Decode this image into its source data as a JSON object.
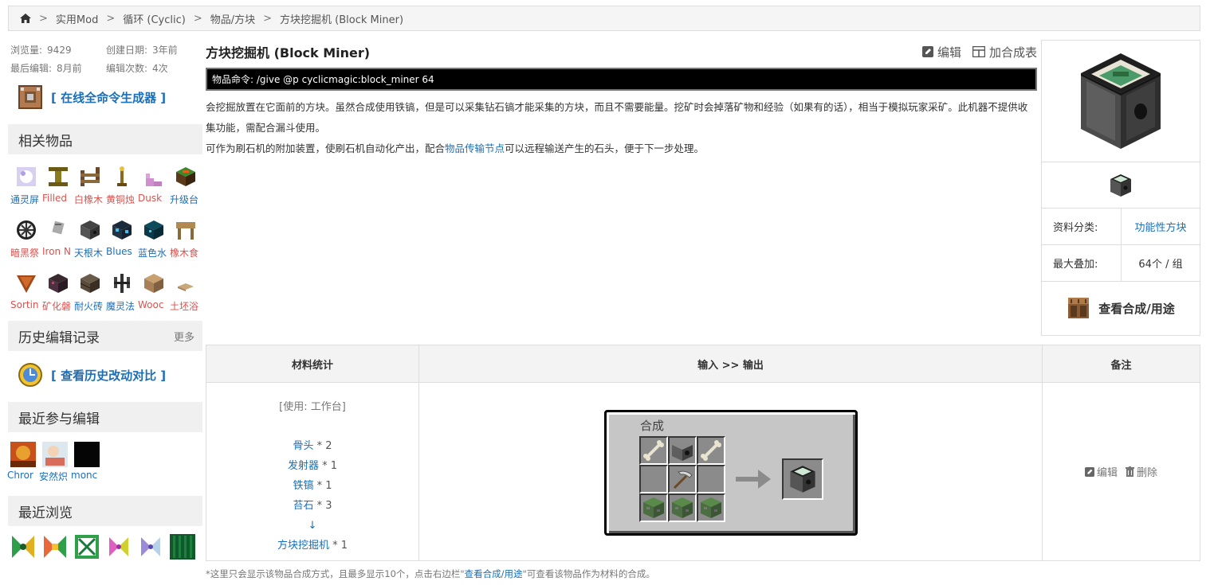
{
  "breadcrumb": {
    "home_icon": "home-icon",
    "items": [
      "实用Mod",
      "循环 (Cyclic)",
      "物品/方块",
      "方块挖掘机 (Block Miner)"
    ]
  },
  "sidebar": {
    "stats": {
      "views_label": "浏览量:",
      "views": "9429",
      "created_label": "创建日期:",
      "created": "3年前",
      "last_edit_label": "最后编辑:",
      "last_edit": "8月前",
      "edit_count_label": "编辑次数:",
      "edit_count": "4次"
    },
    "generator": "[ 在线全命令生成器 ]",
    "related_title": "相关物品",
    "related_items": [
      {
        "name": "通灵屏",
        "color": "blue"
      },
      {
        "name": "Filled",
        "color": "red"
      },
      {
        "name": "白橡木",
        "color": "red"
      },
      {
        "name": "黄铜烛",
        "color": "red"
      },
      {
        "name": "Dusk",
        "color": "red"
      },
      {
        "name": "升级台",
        "color": "blue"
      },
      {
        "name": "暗黑祭",
        "color": "red"
      },
      {
        "name": "Iron N",
        "color": "red"
      },
      {
        "name": "天根木",
        "color": "blue"
      },
      {
        "name": "Blues",
        "color": "blue"
      },
      {
        "name": "蓝色水",
        "color": "blue"
      },
      {
        "name": "橡木食",
        "color": "red"
      },
      {
        "name": "Sortin",
        "color": "red"
      },
      {
        "name": "矿化磐",
        "color": "red"
      },
      {
        "name": "耐火砖",
        "color": "blue"
      },
      {
        "name": "魔灵法",
        "color": "blue"
      },
      {
        "name": "Wooc",
        "color": "red"
      },
      {
        "name": "土坯浴",
        "color": "red"
      }
    ],
    "history_title": "历史编辑记录",
    "history_more": "更多",
    "history_compare": "[ 查看历史改动对比 ]",
    "recent_editors_title": "最近参与编辑",
    "recent_editors": [
      "Chror",
      "安然炽",
      "monc"
    ],
    "recent_views_title": "最近浏览"
  },
  "main": {
    "title": "方块挖掘机 (Block Miner)",
    "edit_label": "编辑",
    "add_recipe_label": "加合成表",
    "command_label": "物品命令:",
    "command": "/give @p cyclicmagic:block_miner 64",
    "desc1": "会挖掘放置在它面前的方块。虽然合成使用铁镐，但是可以采集钻石镐才能采集的方块，而且不需要能量。挖矿时会掉落矿物和经验（如果有的话），相当于模拟玩家采矿。此机器不提供收集功能，需配合漏斗使用。",
    "desc2_pre": "可作为刷石机的附加装置，使刷石机自动化产出，配合",
    "desc2_link": "物品传输节点",
    "desc2_post": "可以远程输送产生的石头，便于下一步处理。"
  },
  "infobox": {
    "category_label": "资料分类:",
    "category": "功能性方块",
    "stack_label": "最大叠加:",
    "stack": "64个 / 组",
    "view_recipe": "查看合成/用途"
  },
  "recipe": {
    "col1": "材料统计",
    "col2": "输入 >> 输出",
    "col3": "备注",
    "tool": "[使用: 工作台]",
    "materials": [
      {
        "name": "骨头",
        "qty": "* 2"
      },
      {
        "name": "发射器",
        "qty": "* 1"
      },
      {
        "name": "铁镐",
        "qty": "* 1"
      },
      {
        "name": "苔石",
        "qty": "* 3"
      }
    ],
    "arrow": "↓",
    "result": {
      "name": "方块挖掘机",
      "qty": "* 1"
    },
    "gui_title": "合成",
    "edit": "编辑",
    "delete": "删除"
  },
  "footnote_pre": "*这里只会显示该物品合成方式，且最多显示10个，点击右边栏\"",
  "footnote_link": "查看合成/用途",
  "footnote_post": "\"可查看该物品作为材料的合成。"
}
